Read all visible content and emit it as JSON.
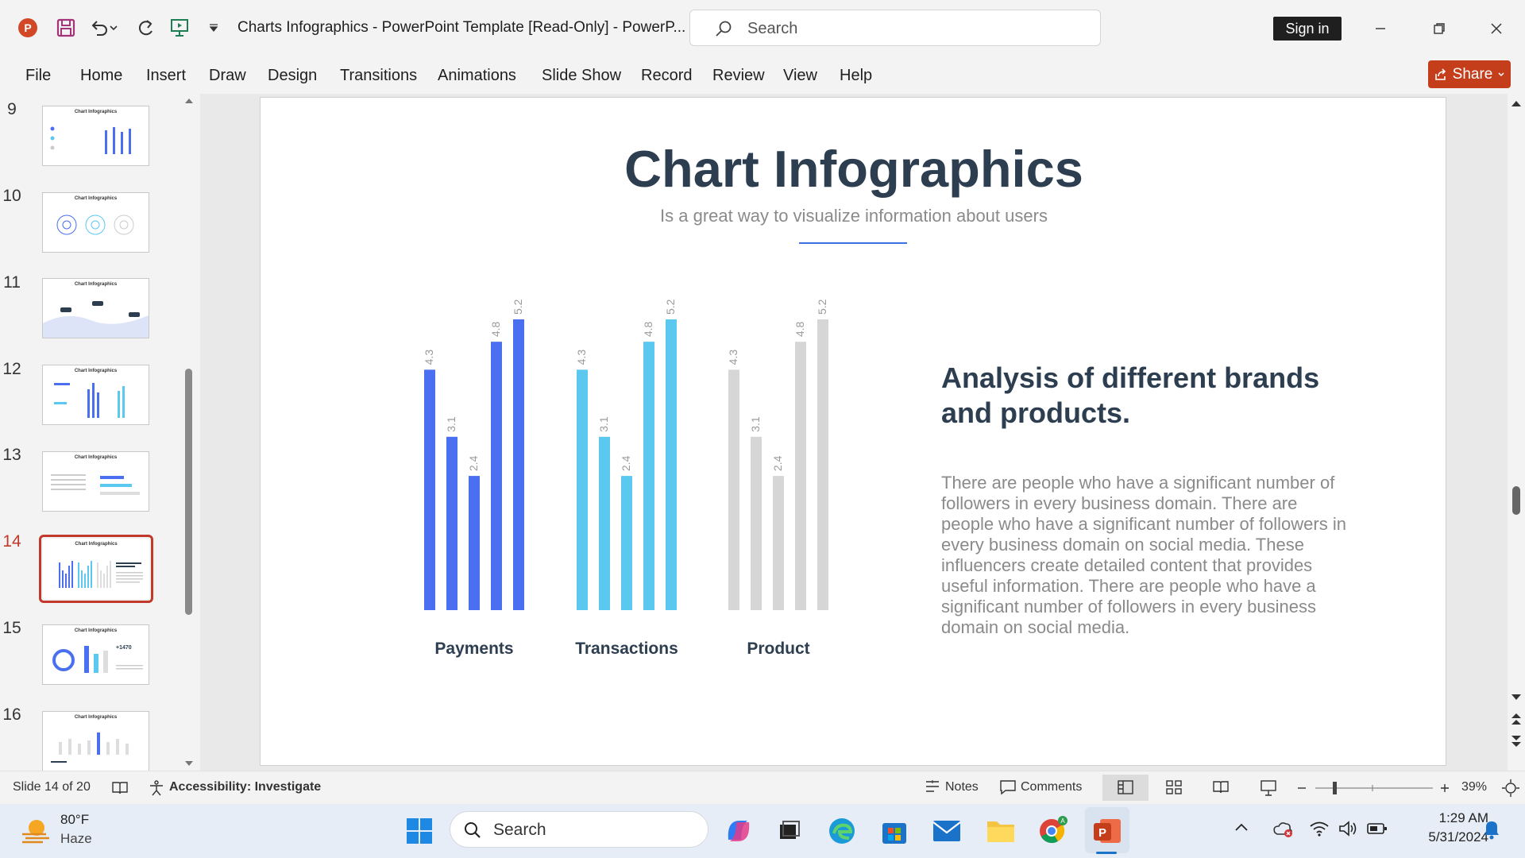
{
  "titlebar": {
    "doc_title": "Charts Infographics - PowerPoint Template [Read-Only]  -  PowerP...",
    "search_placeholder": "Search",
    "sign_in": "Sign in"
  },
  "menu": [
    "File",
    "Home",
    "Insert",
    "Draw",
    "Design",
    "Transitions",
    "Animations",
    "Slide Show",
    "Record",
    "Review",
    "View",
    "Help"
  ],
  "share_label": "Share",
  "thumbnails": [
    {
      "num": "9",
      "title": "Chart Infographics"
    },
    {
      "num": "10",
      "title": "Chart Infographics"
    },
    {
      "num": "11",
      "title": "Chart Infographics"
    },
    {
      "num": "12",
      "title": "Chart Infographics"
    },
    {
      "num": "13",
      "title": "Chart Infographics"
    },
    {
      "num": "14",
      "title": "Chart Infographics"
    },
    {
      "num": "15",
      "title": "Chart Infographics"
    },
    {
      "num": "16",
      "title": "Chart Infographics"
    }
  ],
  "selected_slide": "14",
  "slide": {
    "title": "Chart Infographics",
    "subtitle": "Is a great way to visualize information about users",
    "analysis_title": "Analysis of different brands and products.",
    "analysis_body": "There are people who have a significant number of followers in every business domain. There are people who have a significant number of followers in every business domain on social media. These influencers create detailed content that provides useful information. There are people who have a significant number of followers in every business domain on social media."
  },
  "chart_data": {
    "type": "bar",
    "groups": [
      {
        "name": "Payments",
        "color": "#4a6ff0",
        "values": [
          4.3,
          3.1,
          2.4,
          4.8,
          5.2
        ]
      },
      {
        "name": "Transactions",
        "color": "#5bc8f0",
        "values": [
          4.3,
          3.1,
          2.4,
          4.8,
          5.2
        ]
      },
      {
        "name": "Product",
        "color": "#d6d6d6",
        "values": [
          4.3,
          3.1,
          2.4,
          4.8,
          5.2
        ]
      }
    ],
    "ylim": [
      0,
      5.2
    ],
    "value_labels": true
  },
  "statusbar": {
    "slide_info": "Slide 14 of 20",
    "accessibility": "Accessibility: Investigate",
    "notes": "Notes",
    "comments": "Comments",
    "zoom": "39%"
  },
  "taskbar": {
    "weather_temp": "80°F",
    "weather_desc": "Haze",
    "search_placeholder": "Search",
    "time": "1:29 AM",
    "date": "5/31/2024"
  }
}
